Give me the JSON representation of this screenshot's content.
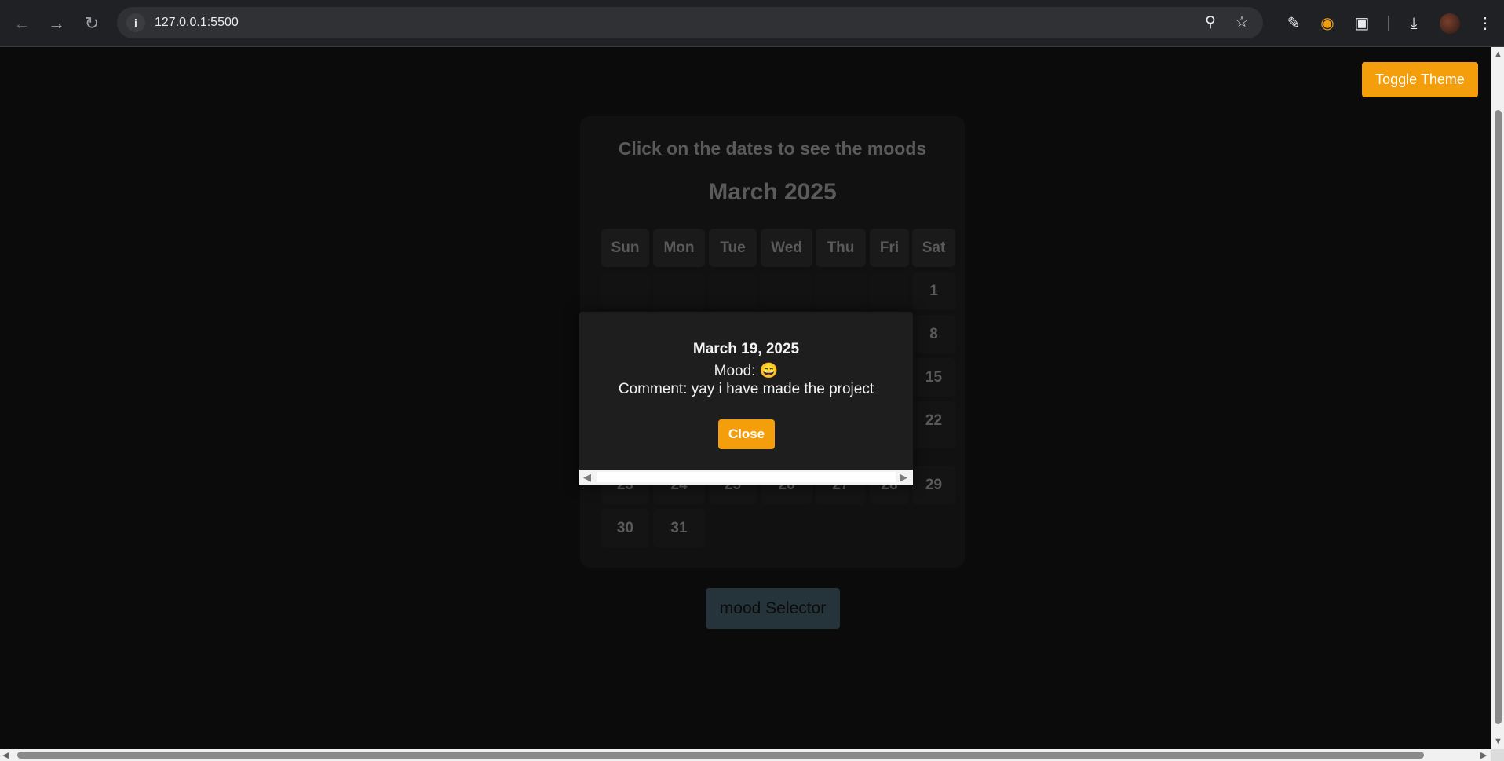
{
  "browser": {
    "url": "127.0.0.1:5500",
    "icons": {
      "back": "back-arrow-icon",
      "forward": "forward-arrow-icon",
      "reload": "reload-icon",
      "site_info": "info-icon",
      "zoom": "zoom-icon",
      "bookmark": "star-icon",
      "extension_pen": "pen-extension-icon",
      "extension_bug": "bug-extension-icon",
      "extensions": "puzzle-icon",
      "downloads": "download-icon",
      "menu": "kebab-menu-icon"
    }
  },
  "page": {
    "toggle_theme_label": "Toggle Theme",
    "calendar": {
      "heading": "Click on the dates to see the moods",
      "month_label": "March 2025",
      "weekdays": [
        "Sun",
        "Mon",
        "Tue",
        "Wed",
        "Thu",
        "Fri",
        "Sat"
      ],
      "weeks": [
        [
          "",
          "",
          "",
          "",
          "",
          "",
          "1"
        ],
        [
          "",
          "",
          "",
          "",
          "",
          "",
          "8"
        ],
        [
          "",
          "",
          "",
          "",
          "",
          "",
          "15"
        ],
        [
          "",
          "",
          "",
          "",
          "",
          "",
          "22"
        ],
        [
          "23",
          "24",
          "25",
          "26",
          "27",
          "28",
          "29"
        ],
        [
          "30",
          "31",
          "",
          "",
          "",
          "",
          ""
        ]
      ]
    },
    "mood_selector_label": "mood Selector",
    "popup": {
      "date": "March 19, 2025",
      "mood": "Mood: 😄",
      "comment": "Comment: yay i have made the project",
      "close_label": "Close"
    }
  },
  "colors": {
    "accent": "#f59e0b",
    "background": "#0b0b0b",
    "popup_background": "#1e1e1e"
  }
}
